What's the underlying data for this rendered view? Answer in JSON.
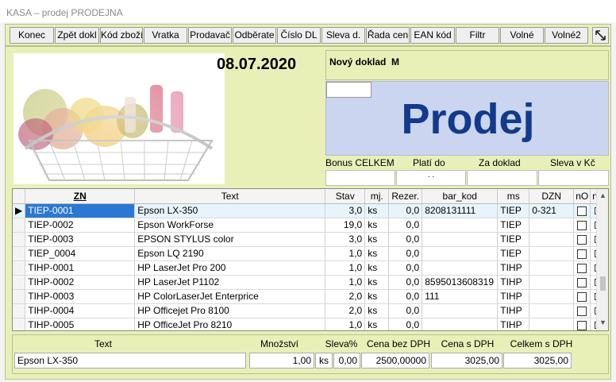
{
  "window": {
    "title": "KASA – prodej PRODEJNA"
  },
  "toolbar": {
    "buttons": [
      "Konec",
      "Zpět dokl",
      "Kód zboží",
      "Vratka",
      "Prodavač",
      "Odběrate",
      "Číslo DL",
      "Sleva d.",
      "Řada cen",
      "EAN kód",
      "Filtr",
      "Volné",
      "Volné2"
    ]
  },
  "header": {
    "date": "08.07.2020",
    "doc_label": "Nový doklad",
    "doc_code": "M",
    "mode": "Prodej",
    "bonus_labels": [
      "Bonus CELKEM",
      "Platí do",
      "Za doklad",
      "Sleva v Kč"
    ],
    "plati_do_value": ". ."
  },
  "grid": {
    "columns": [
      "ZN",
      "Text",
      "Stav",
      "mj.",
      "Rezer.",
      "bar_kod",
      "ms",
      "DZN",
      "nO",
      "nS"
    ],
    "rows": [
      {
        "zn": "TIEP-0001",
        "text": "Epson LX-350",
        "stav": "3,0",
        "mj": "ks",
        "rezer": "0,0",
        "bar_kod": "8208131111",
        "ms": "TIEP",
        "dzn": "0-321"
      },
      {
        "zn": "TIEP-0002",
        "text": "Epson WorkForse",
        "stav": "19,0",
        "mj": "ks",
        "rezer": "0,0",
        "bar_kod": "",
        "ms": "TIEP",
        "dzn": ""
      },
      {
        "zn": "TIEP-0003",
        "text": "EPSON STYLUS color",
        "stav": "3,0",
        "mj": "ks",
        "rezer": "0,0",
        "bar_kod": "",
        "ms": "TIEP",
        "dzn": ""
      },
      {
        "zn": "TIEP_0004",
        "text": "Epson LQ 2190",
        "stav": "1,0",
        "mj": "ks",
        "rezer": "0,0",
        "bar_kod": "",
        "ms": "TIEP",
        "dzn": ""
      },
      {
        "zn": "TIHP-0001",
        "text": "HP LaserJet Pro 200",
        "stav": "1,0",
        "mj": "ks",
        "rezer": "0,0",
        "bar_kod": "",
        "ms": "TIHP",
        "dzn": ""
      },
      {
        "zn": "TIHP-0002",
        "text": "HP LaserJet P1102",
        "stav": "1,0",
        "mj": "ks",
        "rezer": "0,0",
        "bar_kod": "8595013608319",
        "ms": "TIHP",
        "dzn": ""
      },
      {
        "zn": "TIHP-0003",
        "text": "HP ColorLaserJet Enterprice",
        "stav": "2,0",
        "mj": "ks",
        "rezer": "0,0",
        "bar_kod": "111",
        "ms": "TIHP",
        "dzn": ""
      },
      {
        "zn": "TIHP-0004",
        "text": "HP Officejet Pro 8100",
        "stav": "2,0",
        "mj": "ks",
        "rezer": "0,0",
        "bar_kod": "",
        "ms": "TIHP",
        "dzn": ""
      },
      {
        "zn": "TIHP-0005",
        "text": "HP OfficeJet Pro 8210",
        "stav": "1,0",
        "mj": "ks",
        "rezer": "0,0",
        "bar_kod": "",
        "ms": "TIHP",
        "dzn": ""
      }
    ]
  },
  "bottom": {
    "labels": [
      "Text",
      "Množství",
      "Sleva%",
      "Cena bez DPH",
      "Cena s DPH",
      "Celkem s DPH"
    ],
    "text": "Epson LX-350",
    "mnozstvi": "1,00",
    "unit": "ks",
    "sleva": "0,00",
    "cena_bez": "2500,00000",
    "cena_s": "3025,00",
    "celkem": "3025,00"
  },
  "colors": {
    "panel": "#e8f0b8",
    "prodej_bg": "#cbd5ef",
    "prodej_text": "#123a8c",
    "selection": "#2a78d4"
  }
}
